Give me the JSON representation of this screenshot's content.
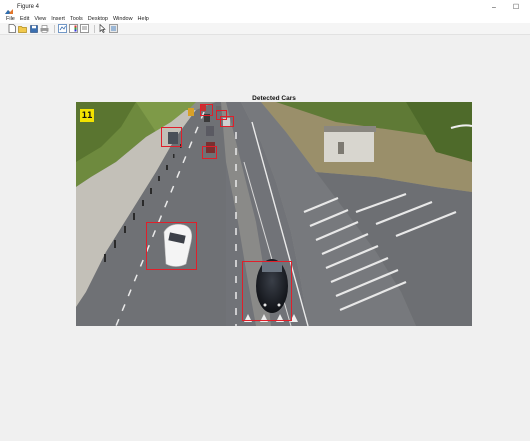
{
  "window": {
    "title": "Figure 4",
    "minimize_glyph": "–",
    "maximize_glyph": "☐"
  },
  "menu": {
    "items": [
      "File",
      "Edit",
      "View",
      "Insert",
      "Tools",
      "Desktop",
      "Window",
      "Help"
    ]
  },
  "toolbar": {
    "buttons": [
      {
        "name": "new-figure-icon"
      },
      {
        "name": "open-file-icon"
      },
      {
        "name": "save-icon"
      },
      {
        "name": "print-icon"
      },
      {
        "name": "link-plot-icon"
      },
      {
        "name": "insert-colorbar-icon"
      },
      {
        "name": "insert-legend-icon"
      },
      {
        "name": "pointer-icon"
      },
      {
        "name": "property-editor-icon"
      }
    ]
  },
  "figure": {
    "title": "Detected Cars",
    "frame_number": "11",
    "box_color": "#e01f2a",
    "badge_color": "#f2e300"
  }
}
